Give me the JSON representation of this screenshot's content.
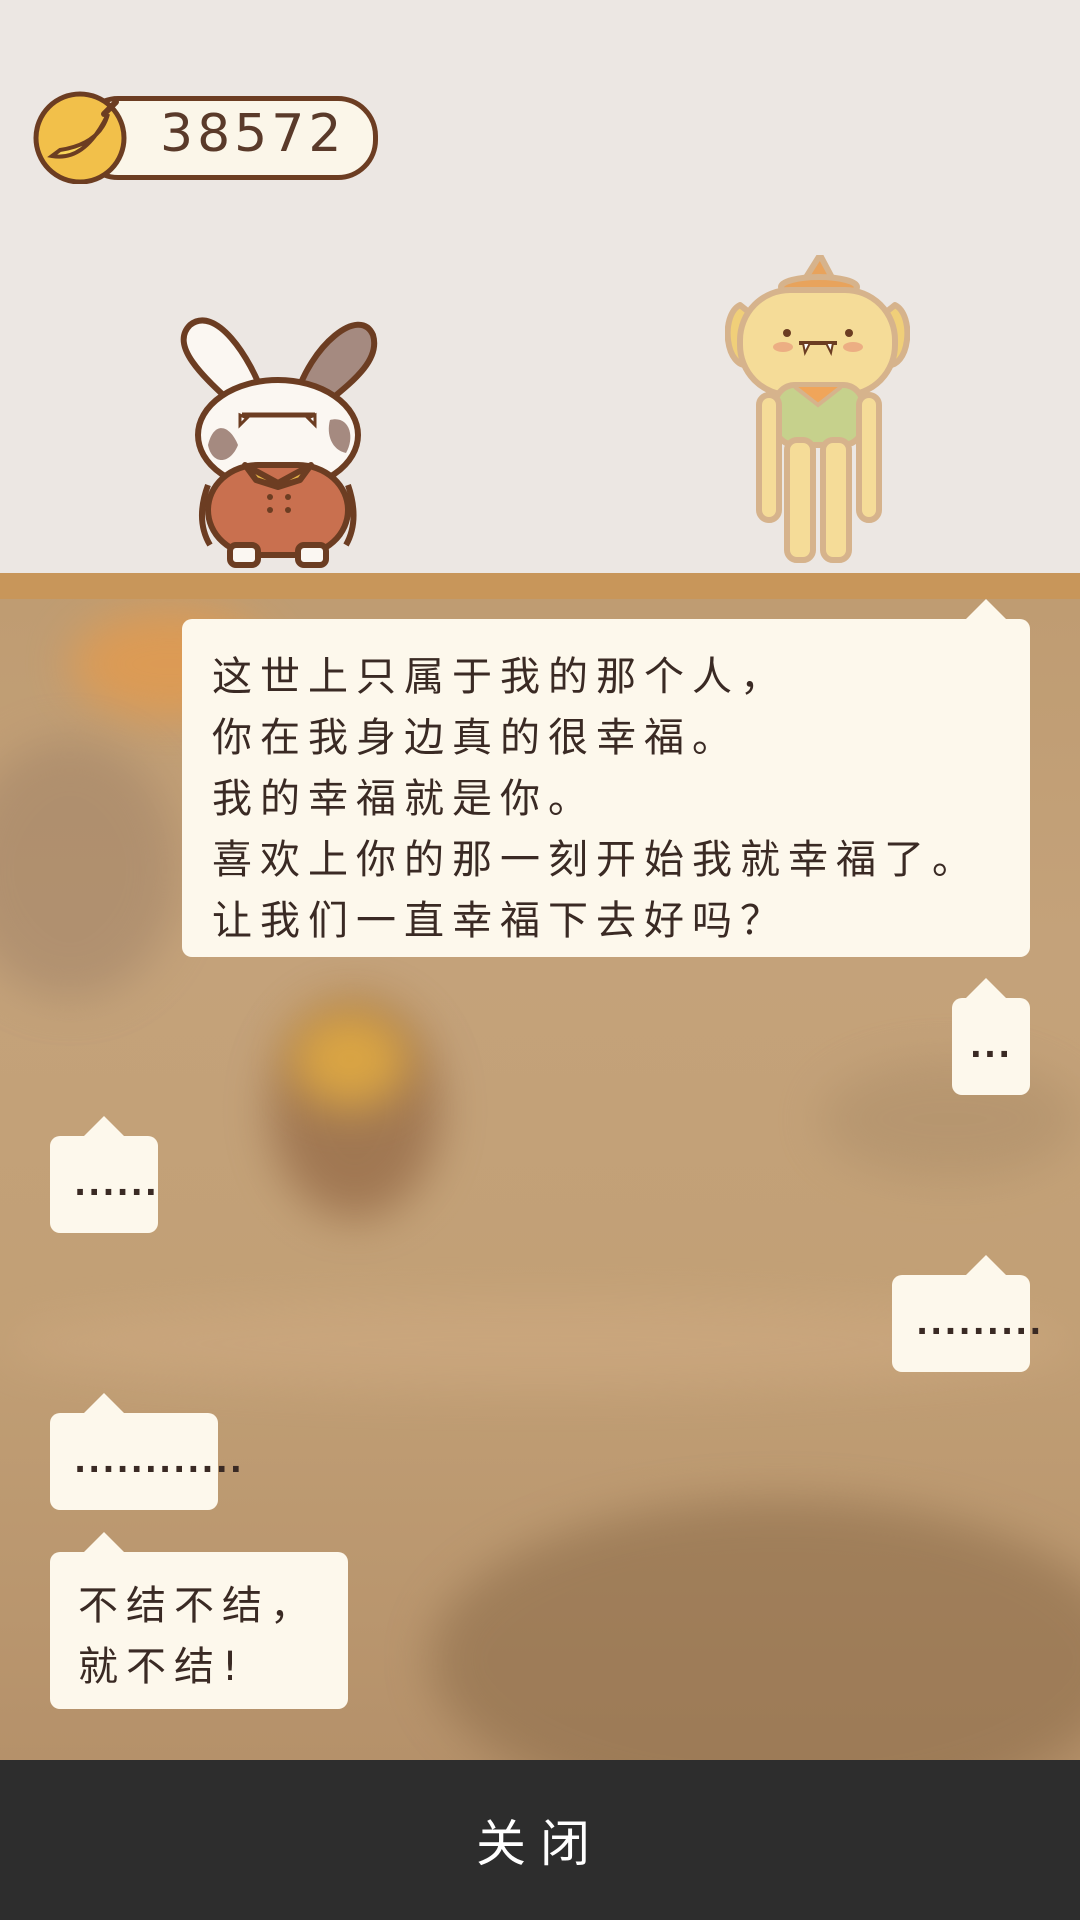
{
  "hud": {
    "banana_count": "38572",
    "currency_icon": "banana-icon"
  },
  "characters": {
    "left": "bunny-character",
    "right": "dog-character"
  },
  "dialogue": [
    {
      "speaker": "right",
      "text": "这世上只属于我的那个人，\n你在我身边真的很幸福。\n我的幸福就是你。\n喜欢上你的那一刻开始我就幸福了。\n让我们一直幸福下去好吗？"
    },
    {
      "speaker": "right",
      "text": "..."
    },
    {
      "speaker": "left",
      "text": "......"
    },
    {
      "speaker": "right",
      "text": "........."
    },
    {
      "speaker": "left",
      "text": "............"
    },
    {
      "speaker": "left",
      "text": "不结不结，\n就不结!"
    }
  ],
  "footer": {
    "close_label": "关闭"
  },
  "colors": {
    "background_top": "#ece7e3",
    "floor": "#c8965a",
    "bubble": "#fdf8ec",
    "footer": "#2d2d2d"
  }
}
